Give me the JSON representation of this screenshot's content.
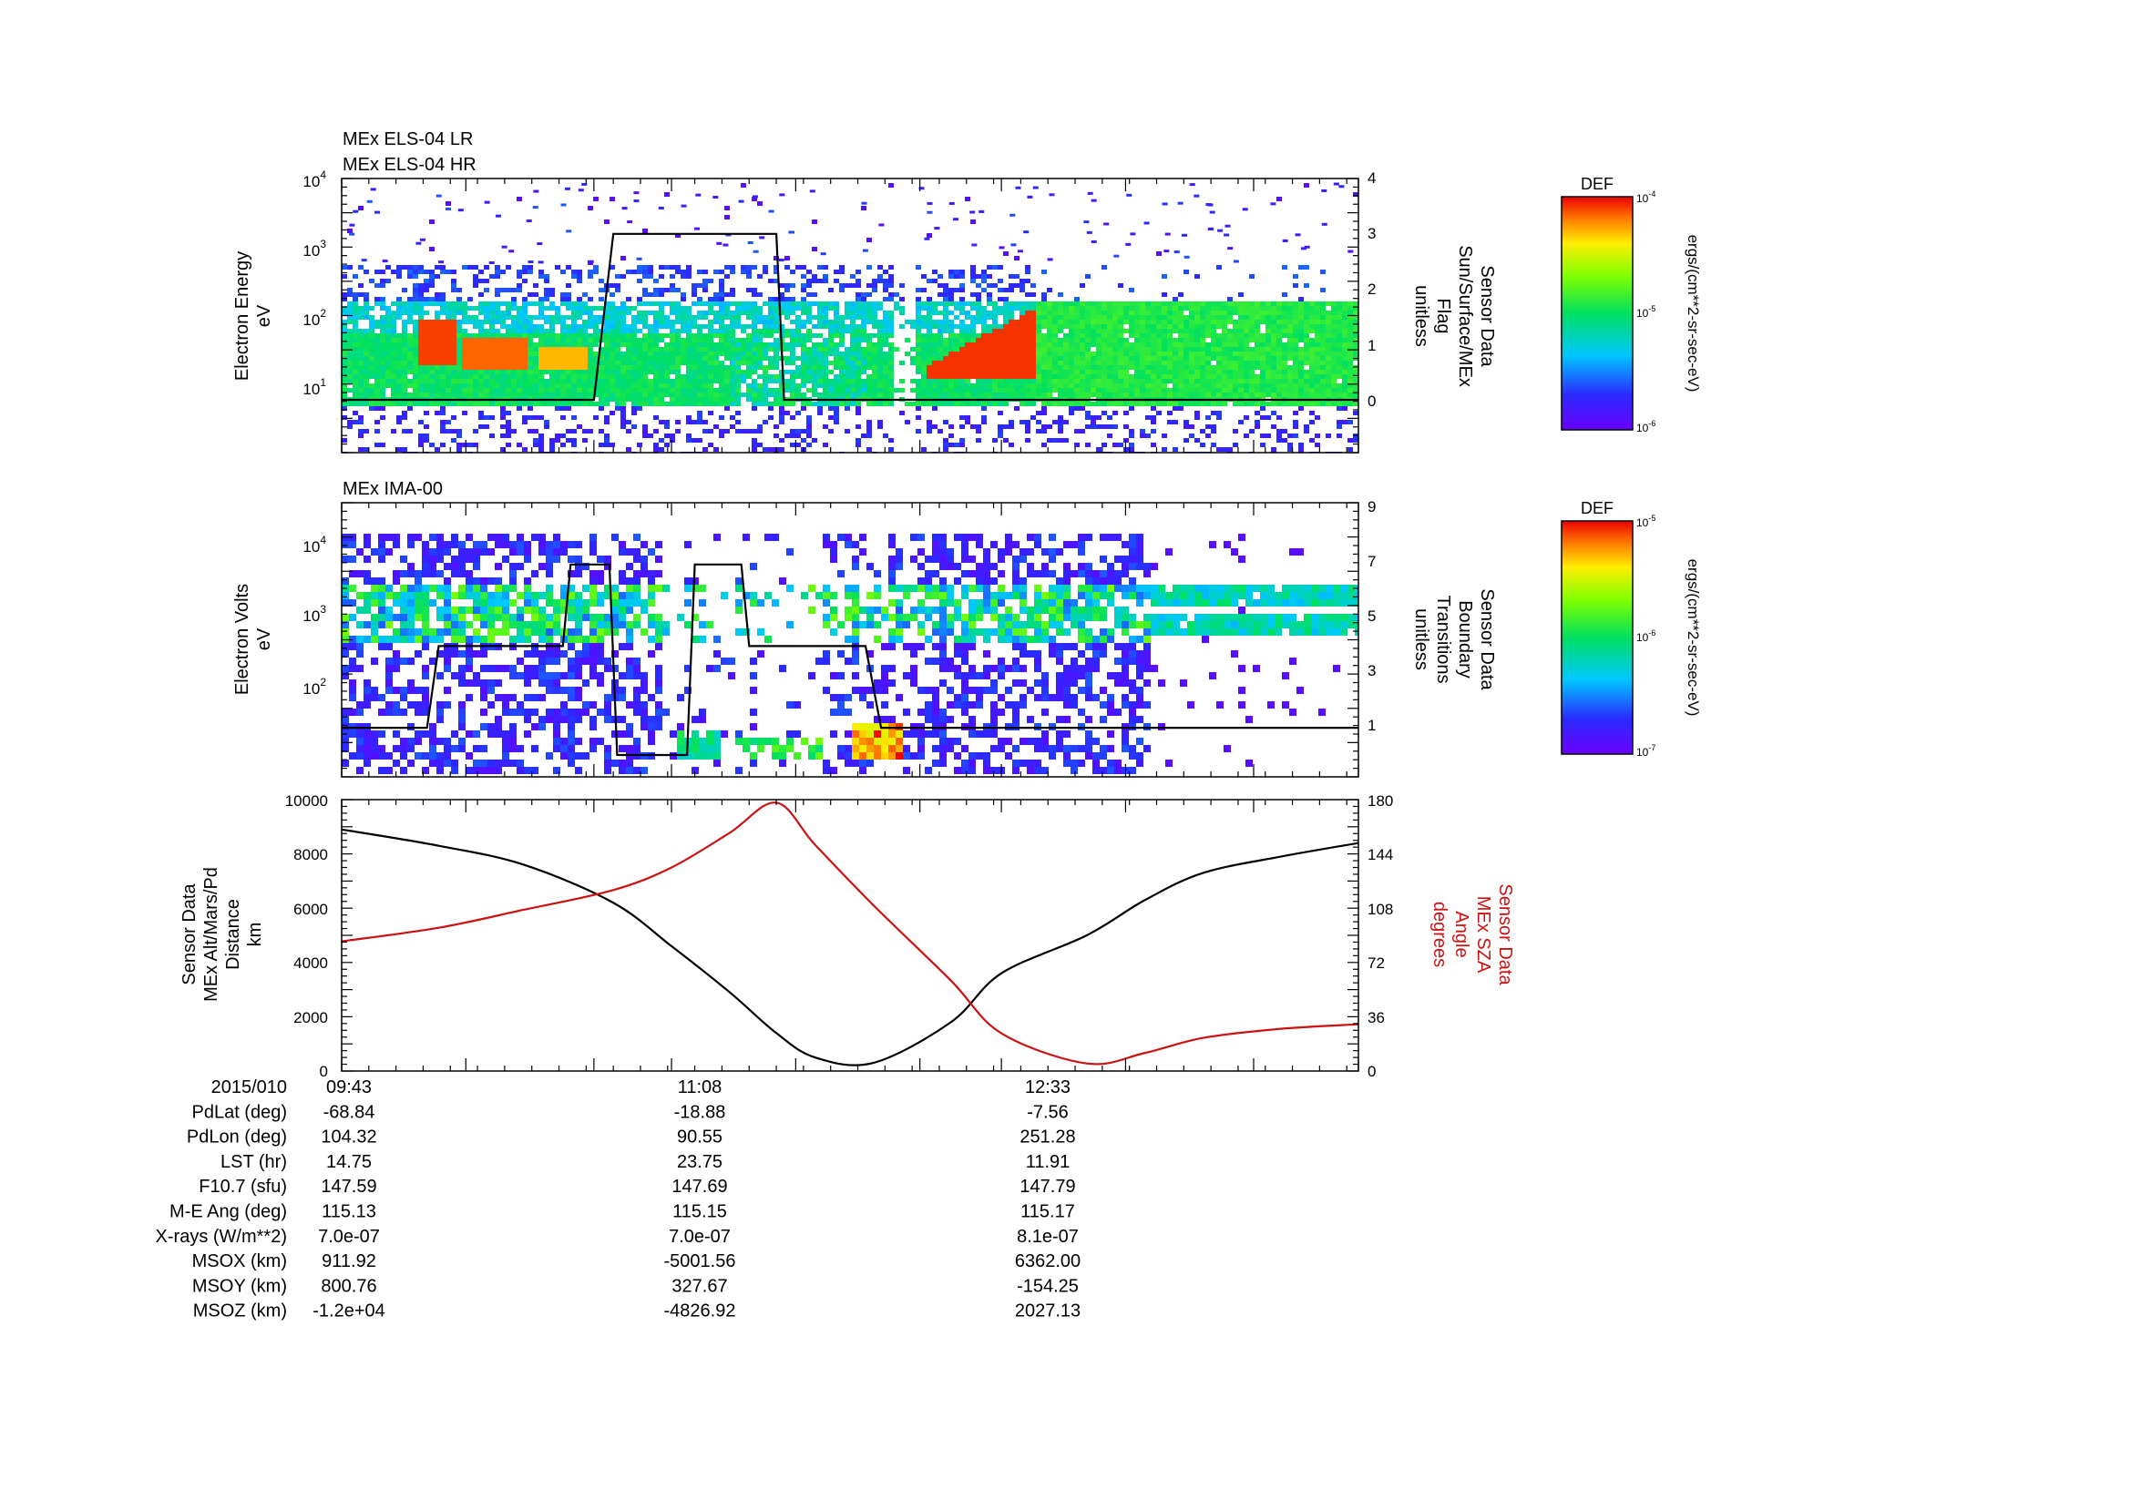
{
  "panels": {
    "p1": {
      "titles": [
        "MEx ELS-04 LR",
        "MEx ELS-04 HR"
      ],
      "ylabel": [
        "Electron Energy",
        "eV"
      ],
      "yticks": [
        {
          "base": "10",
          "exp": "1"
        },
        {
          "base": "10",
          "exp": "2"
        },
        {
          "base": "10",
          "exp": "3"
        },
        {
          "base": "10",
          "exp": "4"
        }
      ],
      "right_ticks": [
        "0",
        "1",
        "2",
        "3",
        "4"
      ],
      "right_label": [
        "Sensor Data",
        "Sun/Surface/MEx",
        "Flag",
        "unitless"
      ],
      "colorbar": {
        "title": "DEF",
        "ticks": [
          {
            "base": "10",
            "exp": "-4"
          },
          {
            "base": "10",
            "exp": "-5"
          },
          {
            "base": "10",
            "exp": "-6"
          }
        ],
        "unit": "ergs/(cm**2-sr-sec-eV)"
      }
    },
    "p2": {
      "titles": [
        "MEx IMA-00"
      ],
      "ylabel": [
        "Electron Volts",
        "eV"
      ],
      "yticks": [
        {
          "base": "10",
          "exp": "2"
        },
        {
          "base": "10",
          "exp": "3"
        },
        {
          "base": "10",
          "exp": "4"
        }
      ],
      "right_ticks": [
        "1",
        "3",
        "5",
        "7",
        "9"
      ],
      "right_label": [
        "Sensor Data",
        "Boundary",
        "Transitions",
        "unitless"
      ],
      "colorbar": {
        "title": "DEF",
        "ticks": [
          {
            "base": "10",
            "exp": "-5"
          },
          {
            "base": "10",
            "exp": "-6"
          },
          {
            "base": "10",
            "exp": "-7"
          }
        ],
        "unit": "ergs/(cm**2-sr-sec-eV)"
      }
    },
    "p3": {
      "ylabel": [
        "Sensor Data",
        "MEx Alt/Mars/Pd",
        "Distance",
        "km"
      ],
      "left_ticks": [
        "0",
        "2000",
        "4000",
        "6000",
        "8000",
        "10000"
      ],
      "right_ticks": [
        "0",
        "36",
        "72",
        "108",
        "144",
        "180"
      ],
      "right_label": [
        "Sensor Data",
        "MEx SZA",
        "Angle",
        "degrees"
      ]
    }
  },
  "chart_data": [
    {
      "type": "heatmap",
      "title": "MEx ELS-04 LR / MEx ELS-04 HR",
      "ylabel": "Electron Energy eV",
      "yscale": "log",
      "colorbar_label": "DEF ergs/(cm**2-sr-sec-eV)",
      "colorbar_range": [
        "1e-6",
        "1e-4"
      ],
      "overlay": {
        "name": "Sensor Data Sun/Surface/MEx Flag unitless",
        "ylim": [
          0,
          4
        ],
        "x": [
          "09:43",
          "10:48",
          "10:53",
          "11:35",
          "11:37",
          "11:50",
          "12:33",
          "14:05"
        ],
        "y": [
          0,
          0,
          3,
          3,
          0,
          0,
          0,
          0
        ]
      }
    },
    {
      "type": "heatmap",
      "title": "MEx IMA-00",
      "ylabel": "Electron Volts eV",
      "yscale": "log",
      "colorbar_label": "DEF ergs/(cm**2-sr-sec-eV)",
      "colorbar_range": [
        "1e-7",
        "1e-5"
      ],
      "overlay": {
        "name": "Sensor Data Boundary Transitions unitless",
        "ylim": [
          0,
          9
        ],
        "x": [
          "09:43",
          "10:05",
          "10:08",
          "10:40",
          "10:42",
          "10:52",
          "10:54",
          "11:12",
          "11:14",
          "11:26",
          "11:28",
          "11:58",
          "12:02",
          "12:10",
          "12:12",
          "13:15",
          "14:05"
        ],
        "y": [
          1,
          1,
          4,
          4,
          7,
          7,
          0,
          0,
          7,
          7,
          4,
          4,
          1,
          1,
          1,
          1,
          1
        ]
      }
    },
    {
      "type": "line",
      "x": [
        "09:43",
        "10:08",
        "10:30",
        "10:53",
        "11:08",
        "11:23",
        "11:35",
        "11:45",
        "12:00",
        "12:20",
        "12:33",
        "12:55",
        "13:10",
        "13:25",
        "13:45",
        "14:05"
      ],
      "xticklabels": [
        "09:43",
        "11:08",
        "12:33"
      ],
      "series": [
        {
          "name": "Sensor Data MEx Alt/Mars/Pd Distance km",
          "color": "#000000",
          "axis": "left",
          "values": [
            8900,
            8300,
            7600,
            6200,
            4600,
            2900,
            1400,
            500,
            300,
            1800,
            3600,
            5000,
            6300,
            7300,
            7900,
            8400
          ]
        },
        {
          "name": "Sensor Data MEx SZA Angle degrees",
          "color": "#cc1111",
          "axis": "right",
          "values": [
            86,
            95,
            107,
            120,
            135,
            158,
            178,
            150,
            110,
            60,
            25,
            5,
            12,
            22,
            28,
            31
          ]
        }
      ],
      "ylim_left": [
        0,
        10000
      ],
      "ylim_right": [
        0,
        180
      ]
    }
  ],
  "table": {
    "rows": [
      {
        "label": "2015/010",
        "v": [
          "09:43",
          "11:08",
          "12:33"
        ]
      },
      {
        "label": "PdLat (deg)",
        "v": [
          "-68.84",
          "-18.88",
          "-7.56"
        ]
      },
      {
        "label": "PdLon (deg)",
        "v": [
          "104.32",
          "90.55",
          "251.28"
        ]
      },
      {
        "label": "LST (hr)",
        "v": [
          "14.75",
          "23.75",
          "11.91"
        ]
      },
      {
        "label": "F10.7 (sfu)",
        "v": [
          "147.59",
          "147.69",
          "147.79"
        ]
      },
      {
        "label": "M-E Ang (deg)",
        "v": [
          "115.13",
          "115.15",
          "115.17"
        ]
      },
      {
        "label": "X-rays (W/m**2)",
        "v": [
          "7.0e-07",
          "7.0e-07",
          "8.1e-07"
        ]
      },
      {
        "label": "MSOX (km)",
        "v": [
          "911.92",
          "-5001.56",
          "6362.00"
        ]
      },
      {
        "label": "MSOY (km)",
        "v": [
          "800.76",
          "327.67",
          "-154.25"
        ]
      },
      {
        "label": "MSOZ (km)",
        "v": [
          "-1.2e+04",
          "-4826.92",
          "2027.13"
        ]
      }
    ]
  }
}
